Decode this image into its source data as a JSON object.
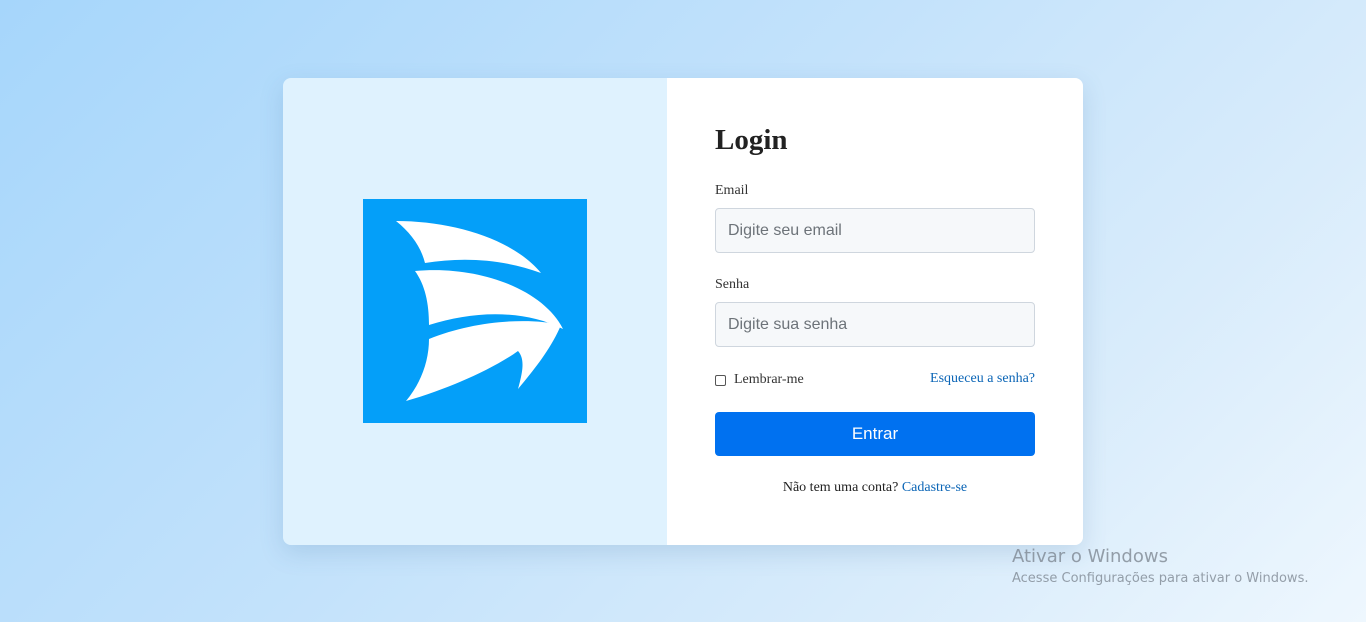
{
  "login": {
    "title": "Login",
    "email_label": "Email",
    "email_placeholder": "Digite seu email",
    "password_label": "Senha",
    "password_placeholder": "Digite sua senha",
    "remember_label": "Lembrar-me",
    "forgot_link": "Esqueceu a senha?",
    "submit_label": "Entrar",
    "signup_prompt": "Não tem uma conta?",
    "signup_link": "Cadastre-se"
  },
  "brand": {
    "logo_icon": "sailboat-logo-icon",
    "logo_color": "#049ff9",
    "panel_color": "#dff2fe",
    "accent_color": "#0071f0",
    "link_color": "#0b65b6"
  },
  "windows_watermark": {
    "title": "Ativar o Windows",
    "subtitle": "Acesse Configurações para ativar o Windows."
  }
}
